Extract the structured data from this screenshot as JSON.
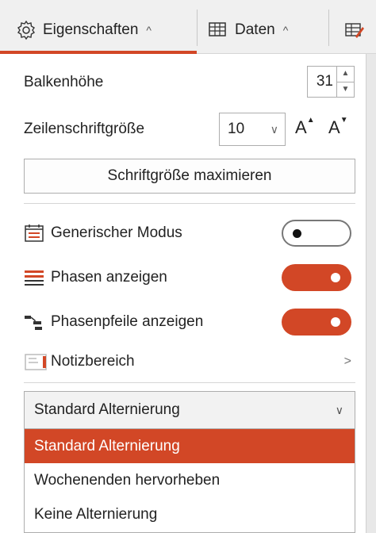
{
  "tabs": {
    "properties": {
      "label": "Eigenschaften",
      "chevron": "^"
    },
    "data": {
      "label": "Daten",
      "chevron": "^"
    }
  },
  "accent_color": "#d24726",
  "bar_height": {
    "label": "Balkenhöhe",
    "value": "31"
  },
  "row_font_size": {
    "label": "Zeilenschriftgröße",
    "value": "10"
  },
  "maximize_button": {
    "label": "Schriftgröße maximieren"
  },
  "generic_mode": {
    "label": "Generischer Modus",
    "state": "off"
  },
  "show_phases": {
    "label": "Phasen anzeigen",
    "state": "on"
  },
  "show_phase_arrows": {
    "label": "Phasenpfeile anzeigen",
    "state": "on"
  },
  "notes_area": {
    "label": "Notizbereich",
    "chevron": ">"
  },
  "alternation": {
    "selected": "Standard Alternierung",
    "options": [
      "Standard Alternierung",
      "Wochenenden hervorheben",
      "Keine Alternierung"
    ]
  }
}
